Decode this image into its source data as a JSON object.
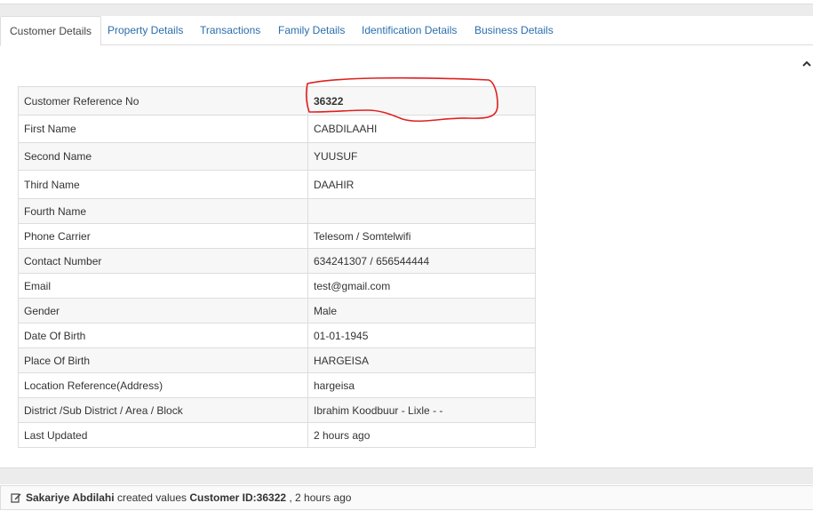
{
  "tabs": [
    {
      "label": "Customer Details",
      "active": true
    },
    {
      "label": "Property Details",
      "active": false
    },
    {
      "label": "Transactions",
      "active": false
    },
    {
      "label": "Family Details",
      "active": false
    },
    {
      "label": "Identification Details",
      "active": false
    },
    {
      "label": "Business Details",
      "active": false
    }
  ],
  "details": [
    {
      "label": "Customer Reference No",
      "value": "36322"
    },
    {
      "label": "First Name",
      "value": "CABDILAAHI"
    },
    {
      "label": "Second Name",
      "value": "YUUSUF"
    },
    {
      "label": "Third Name",
      "value": "DAAHIR"
    },
    {
      "label": "Fourth Name",
      "value": ""
    },
    {
      "label": "Phone Carrier",
      "value": "Telesom / Somtelwifi"
    },
    {
      "label": "Contact Number",
      "value": "634241307 / 656544444"
    },
    {
      "label": "Email",
      "value": "test@gmail.com"
    },
    {
      "label": "Gender",
      "value": "Male"
    },
    {
      "label": "Date Of Birth",
      "value": "01-01-1945"
    },
    {
      "label": "Place Of Birth",
      "value": "HARGEISA"
    },
    {
      "label": "Location Reference(Address)",
      "value": "hargeisa"
    },
    {
      "label": "District /Sub District / Area / Block",
      "value": "Ibrahim Koodbuur - Lixle - -"
    },
    {
      "label": "Last Updated",
      "value": "2 hours ago"
    }
  ],
  "log": {
    "user": "Sakariye Abdilahi",
    "action": " created values ",
    "subject": "Customer ID:36322",
    "time": " , 2 hours ago"
  },
  "icons": {
    "collapse": "chevron-up-icon",
    "log": "edit-icon"
  },
  "colors": {
    "link": "#2a6ead",
    "annotation": "#e02020",
    "row_alt": "#f7f7f7",
    "border": "#dddddd"
  }
}
